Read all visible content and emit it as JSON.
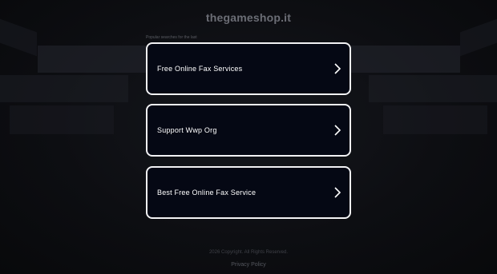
{
  "site": {
    "title": "thegameshop.it"
  },
  "results": {
    "caption": "Popular searches for the last",
    "items": [
      {
        "label": "Free Online Fax Services"
      },
      {
        "label": "Support Wwp Org"
      },
      {
        "label": "Best Free Online Fax Service"
      }
    ]
  },
  "footer": {
    "copyright": "2026 Copyright. All Rights Reserved.",
    "privacy": "Privacy Policy"
  },
  "colors": {
    "background": "#0b0c10",
    "card_background": "#050814",
    "card_border": "#f2f2f4",
    "text": "#ffffff"
  },
  "icons": {
    "result_arrow": "chevron-right-icon"
  }
}
